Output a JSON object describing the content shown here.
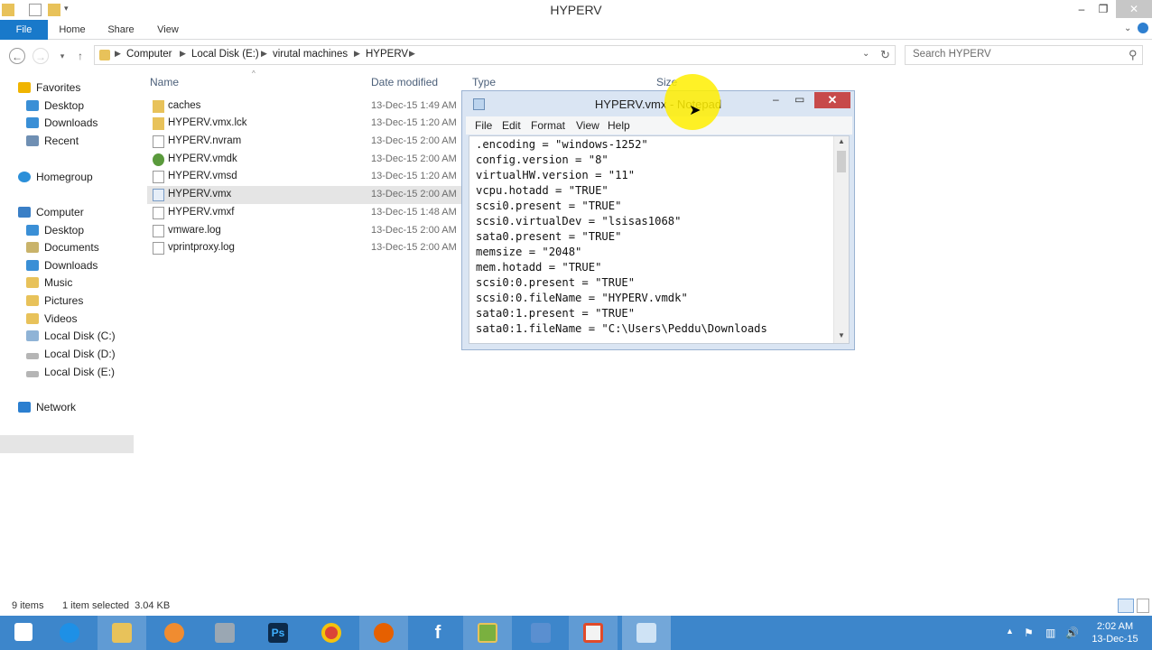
{
  "explorer": {
    "title": "HYPERV",
    "ribbon_tabs": [
      "File",
      "Home",
      "Share",
      "View"
    ],
    "breadcrumb": [
      "Computer",
      "Local Disk (E:)",
      "virutal machines",
      "HYPERV"
    ],
    "search_placeholder": "Search HYPERV",
    "nav": {
      "favorites": "Favorites",
      "favorites_items": [
        "Desktop",
        "Downloads",
        "Recent"
      ],
      "homegroup": "Homegroup",
      "computer": "Computer",
      "computer_items": [
        "Desktop",
        "Documents",
        "Downloads",
        "Music",
        "Pictures",
        "Videos",
        "Local Disk (C:)",
        "Local Disk (D:)",
        "Local Disk (E:)"
      ],
      "network": "Network"
    },
    "columns": [
      "Name",
      "Date modified",
      "Type",
      "Size"
    ],
    "files": [
      {
        "name": "caches",
        "date": "13-Dec-15 1:49 AM"
      },
      {
        "name": "HYPERV.vmx.lck",
        "date": "13-Dec-15 1:20 AM"
      },
      {
        "name": "HYPERV.nvram",
        "date": "13-Dec-15 2:00 AM"
      },
      {
        "name": "HYPERV.vmdk",
        "date": "13-Dec-15 2:00 AM"
      },
      {
        "name": "HYPERV.vmsd",
        "date": "13-Dec-15 1:20 AM"
      },
      {
        "name": "HYPERV.vmx",
        "date": "13-Dec-15 2:00 AM"
      },
      {
        "name": "HYPERV.vmxf",
        "date": "13-Dec-15 1:48 AM"
      },
      {
        "name": "vmware.log",
        "date": "13-Dec-15 2:00 AM"
      },
      {
        "name": "vprintproxy.log",
        "date": "13-Dec-15 2:00 AM"
      }
    ],
    "status": {
      "items": "9 items",
      "selected": "1 item selected  3.04 KB"
    }
  },
  "notepad": {
    "title": "HYPERV.vmx - Notepad",
    "menu": [
      "File",
      "Edit",
      "Format",
      "View",
      "Help"
    ],
    "lines": [
      ".encoding = \"windows-1252\"",
      "config.version = \"8\"",
      "virtualHW.version = \"11\"",
      "vcpu.hotadd = \"TRUE\"",
      "scsi0.present = \"TRUE\"",
      "scsi0.virtualDev = \"lsisas1068\"",
      "sata0.present = \"TRUE\"",
      "memsize = \"2048\"",
      "mem.hotadd = \"TRUE\"",
      "scsi0:0.present = \"TRUE\"",
      "scsi0:0.fileName = \"HYPERV.vmdk\"",
      "sata0:1.present = \"TRUE\"",
      "sata0:1.fileName = \"C:\\Users\\Peddu\\Downloads"
    ]
  },
  "taskbar": {
    "time": "2:02 AM",
    "date": "13-Dec-15",
    "apps": [
      "start-icon",
      "ie-icon",
      "file-explorer-icon",
      "app-icon",
      "app-grid-icon",
      "photoshop-icon",
      "chrome-icon",
      "firefox-icon",
      "facebook-icon",
      "app-icon",
      "app-icon",
      "app-icon",
      "notepad-icon"
    ]
  },
  "colors": {
    "file_tab": "#1979ca",
    "taskbar": "#3d86cb",
    "notepad_frame": "#dae5f3",
    "highlight": "#ffee00"
  }
}
